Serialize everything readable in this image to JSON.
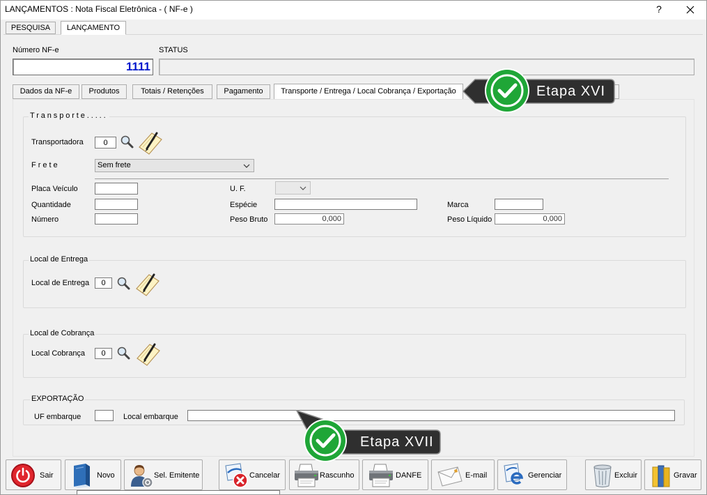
{
  "window": {
    "title": "LANÇAMENTOS : Nota Fiscal Eletrônica - ( NF-e )",
    "help_label": "?"
  },
  "main_tabs": [
    {
      "label": "PESQUISA",
      "active": false
    },
    {
      "label": "LANÇAMENTO",
      "active": true
    }
  ],
  "header": {
    "nfe_number_label": "Número NF-e",
    "nfe_number_value": "1111",
    "status_label": "STATUS",
    "status_value": ""
  },
  "sub_tabs": [
    {
      "label": "Dados da NF-e",
      "active": false
    },
    {
      "label": "Produtos",
      "active": false
    },
    {
      "label": "Totais / Retenções",
      "active": false
    },
    {
      "label": "Pagamento",
      "active": false
    },
    {
      "label": "Transporte / Entrega / Local Cobrança / Exportação",
      "active": true
    }
  ],
  "transporte": {
    "group_title": "Transporte.....",
    "transportadora_label": "Transportadora",
    "transportadora_code": "0",
    "frete_label": "Frete",
    "frete_value": "Sem frete",
    "placa_label": "Placa Veículo",
    "placa_value": "",
    "uf_label": "U. F.",
    "uf_value": "",
    "quantidade_label": "Quantidade",
    "quantidade_value": "",
    "especie_label": "Espécie",
    "especie_value": "",
    "marca_label": "Marca",
    "marca_value": "",
    "numero_label": "Número",
    "numero_value": "",
    "peso_bruto_label": "Peso Bruto",
    "peso_bruto_value": "0,000",
    "peso_liquido_label": "Peso Líquido",
    "peso_liquido_value": "0,000"
  },
  "local_entrega": {
    "group_title": "Local de Entrega",
    "label": "Local de Entrega",
    "code": "0"
  },
  "local_cobranca": {
    "group_title": "Local de Cobrança",
    "label": "Local Cobrança",
    "code": "0"
  },
  "exportacao": {
    "group_title": "EXPORTAÇÃO",
    "uf_label": "UF embarque",
    "uf_value": "",
    "local_label": "Local embarque",
    "local_value": ""
  },
  "step_callouts": [
    {
      "label": "Etapa XVI"
    },
    {
      "label": "Etapa XVII"
    }
  ],
  "toolbar": {
    "sair": "Sair",
    "novo": "Novo",
    "sel_emitente": "Sel. Emitente",
    "cancelar": "Cancelar",
    "rascunho": "Rascunho",
    "danfe": "DANFE",
    "email": "E-mail",
    "gerenciar": "Gerenciar",
    "excluir": "Excluir",
    "gravar": "Gravar"
  },
  "icons": {
    "close": "close-icon",
    "search": "magnifier-icon",
    "edit": "notepad-pencil-icon",
    "dropdown": "chevron-down-icon",
    "sair": "power-icon",
    "novo": "book-icon",
    "sel_emitente": "user-icon",
    "cancelar": "nf-cancel-icon",
    "rascunho": "printer-icon",
    "danfe": "printer-icon",
    "email": "envelope-icon",
    "gerenciar": "nfe-icon",
    "excluir": "trash-icon",
    "gravar": "binders-icon",
    "callout": "check-circle-icon"
  },
  "colors": {
    "window_background": "#f0f0f0",
    "title_bar": "#ffffff",
    "nfe_number_text": "#0018cc",
    "callout_green": "#1fa637",
    "callout_dark": "#2f2f2f"
  }
}
